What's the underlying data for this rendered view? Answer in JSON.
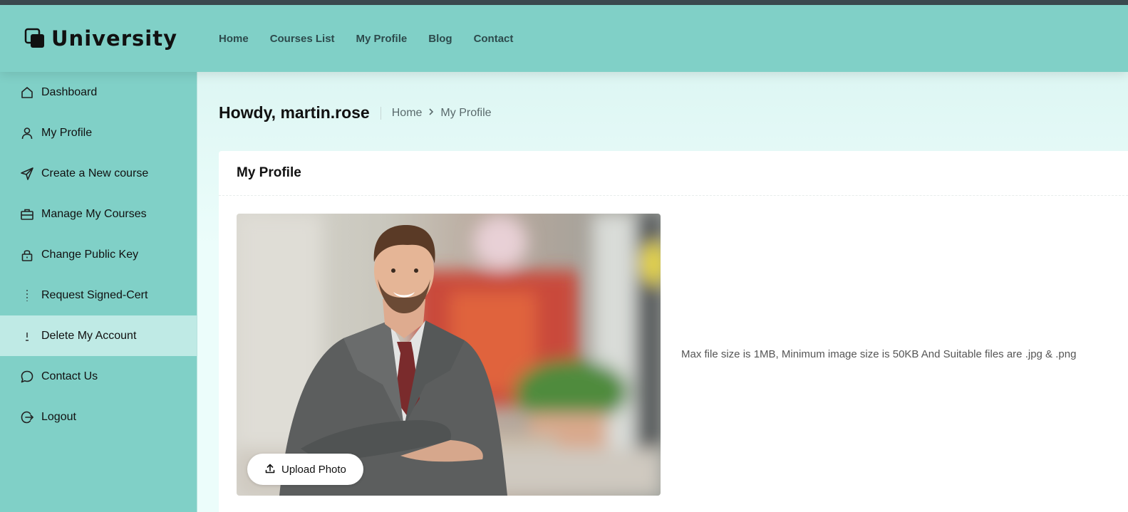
{
  "brand": {
    "name": "University"
  },
  "topnav": [
    {
      "label": "Home"
    },
    {
      "label": "Courses List"
    },
    {
      "label": "My Profile"
    },
    {
      "label": "Blog"
    },
    {
      "label": "Contact"
    }
  ],
  "sidebar": {
    "items": [
      {
        "label": "Dashboard",
        "icon": "home-icon",
        "active": false
      },
      {
        "label": "My Profile",
        "icon": "user-icon",
        "active": false
      },
      {
        "label": "Create a New course",
        "icon": "send-icon",
        "active": false
      },
      {
        "label": "Manage My Courses",
        "icon": "briefcase-icon",
        "active": false
      },
      {
        "label": "Change Public Key",
        "icon": "lock-icon",
        "active": false
      },
      {
        "label": "Request Signed-Cert",
        "icon": "certificate-icon",
        "active": false
      },
      {
        "label": "Delete My Account",
        "icon": "alert-icon",
        "active": true
      },
      {
        "label": "Contact Us",
        "icon": "chat-icon",
        "active": false
      },
      {
        "label": "Logout",
        "icon": "logout-icon",
        "active": false
      }
    ]
  },
  "page": {
    "greeting": "Howdy, martin.rose",
    "breadcrumb": {
      "home": "Home",
      "current": "My Profile"
    }
  },
  "profile_card": {
    "title": "My Profile",
    "upload_label": "Upload Photo",
    "hint": "Max file size is 1MB, Minimum image size is 50KB And Suitable files are .jpg & .png"
  },
  "colors": {
    "teal": "#80d0c7",
    "active": "#bfeae5",
    "background": "#ecfdfb"
  }
}
